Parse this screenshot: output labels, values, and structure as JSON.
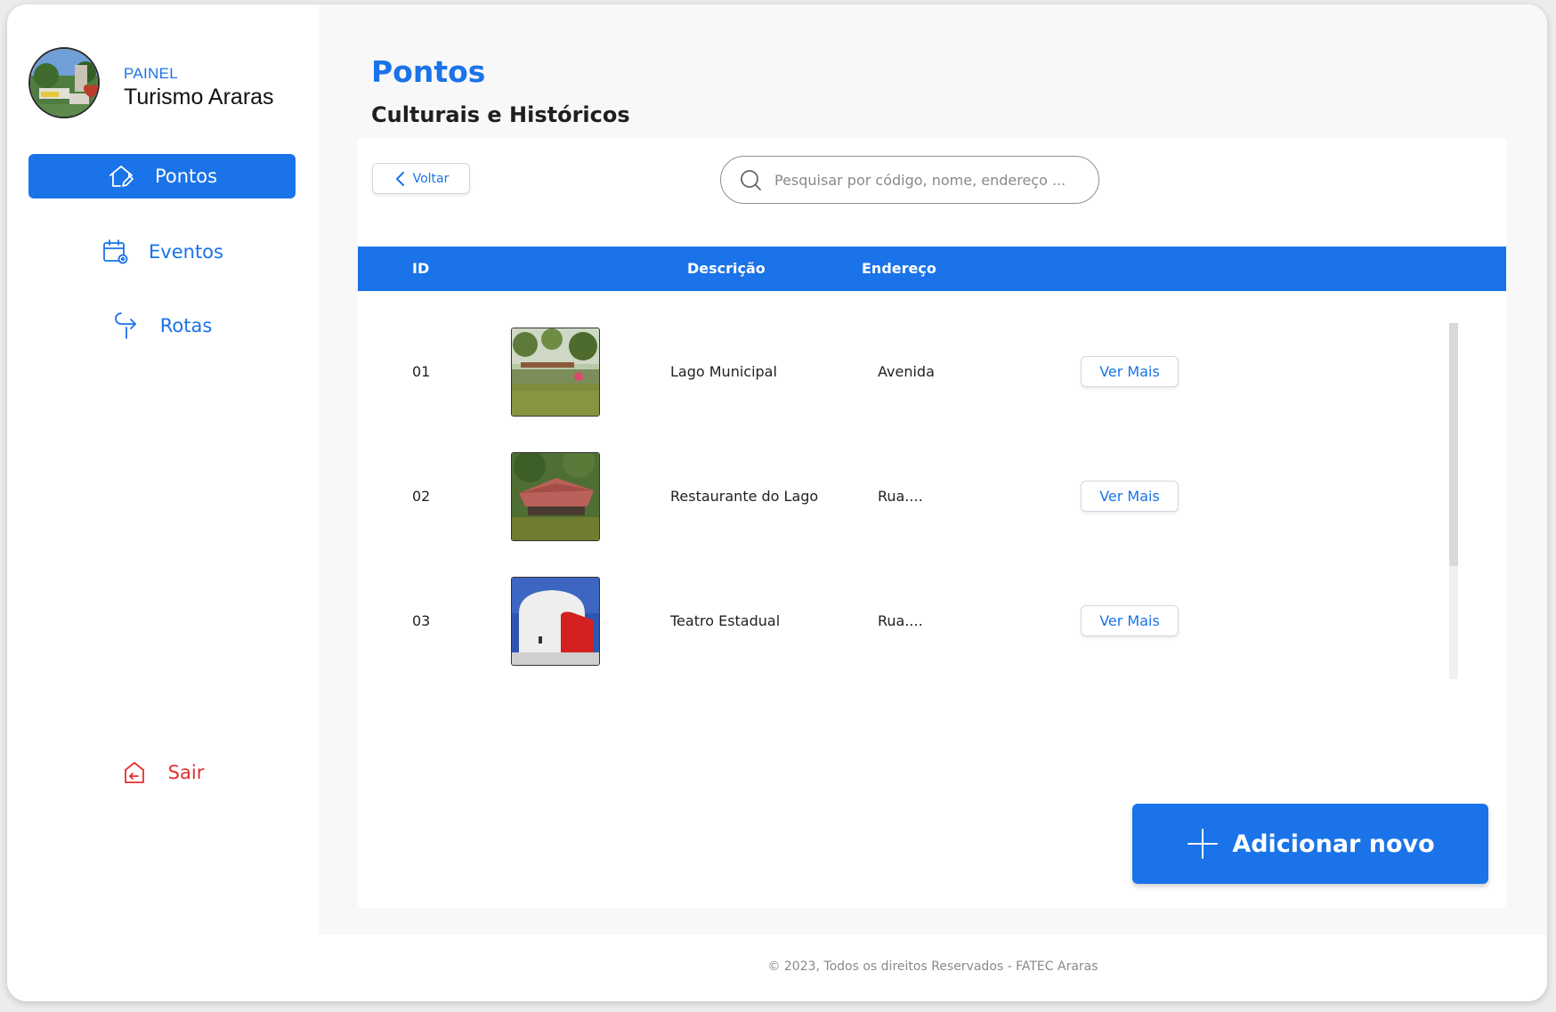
{
  "profile": {
    "subtitle": "PAINEL",
    "title": "Turismo Araras"
  },
  "nav": {
    "pontos": "Pontos",
    "eventos": "Eventos",
    "rotas": "Rotas",
    "sair": "Sair"
  },
  "header": {
    "title": "Pontos",
    "subtitle": "Culturais e Históricos"
  },
  "toolbar": {
    "back_label": "Voltar",
    "search_placeholder": "Pesquisar por código, nome, endereço ..."
  },
  "table": {
    "columns": {
      "id": "ID",
      "descricao": "Descrição",
      "endereco": "Endereço"
    },
    "rows": [
      {
        "id": "01",
        "descricao": "Lago Municipal",
        "endereco": "Avenida",
        "action": "Ver Mais"
      },
      {
        "id": "02",
        "descricao": "Restaurante do Lago",
        "endereco": "Rua....",
        "action": "Ver Mais"
      },
      {
        "id": "03",
        "descricao": "Teatro Estadual",
        "endereco": "Rua....",
        "action": "Ver Mais"
      }
    ]
  },
  "add_button": {
    "label": "Adicionar novo"
  },
  "footer": {
    "text": "© 2023, Todos os direitos Reservados - FATEC Araras"
  },
  "colors": {
    "accent": "#1a73e8",
    "danger": "#e03131"
  }
}
